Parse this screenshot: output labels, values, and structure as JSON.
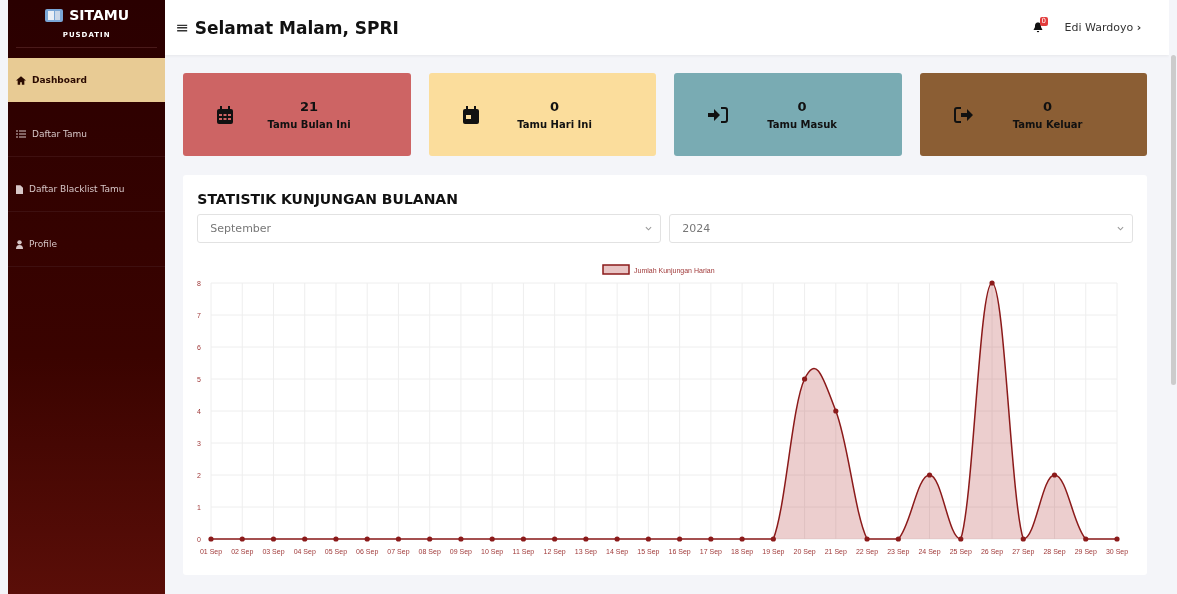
{
  "sidebar": {
    "brand": "SITAMU",
    "subtitle": "PUSDATIN",
    "items": [
      {
        "label": "Dashboard",
        "kind": "home",
        "selected": true
      },
      {
        "label": "Daftar Tamu",
        "kind": "list",
        "selected": false
      },
      {
        "label": "Daftar Blacklist Tamu",
        "kind": "file",
        "selected": false
      },
      {
        "label": "Profile",
        "kind": "user",
        "selected": false
      }
    ]
  },
  "header": {
    "menu_glyph": "≡",
    "greeting": "Selamat Malam, SPRI",
    "notification_count": "0",
    "user": "Edi Wardoyo",
    "user_caret": "›"
  },
  "cards": [
    {
      "value": "21",
      "label": "Tamu Bulan Ini",
      "kind": "calendar-grid",
      "color": "#cd6464"
    },
    {
      "value": "0",
      "label": "Tamu Hari Ini",
      "kind": "calendar-day",
      "color": "#fbdd9c"
    },
    {
      "value": "0",
      "label": "Tamu Masuk",
      "kind": "sign-in",
      "color": "#79abb3"
    },
    {
      "value": "0",
      "label": "Tamu Keluar",
      "kind": "sign-out",
      "color": "#8b5e34"
    }
  ],
  "stats": {
    "title": "STATISTIK KUNJUNGAN BULANAN",
    "month": "September",
    "year": "2024",
    "chart_data": {
      "type": "area",
      "categories": [
        "01 Sep",
        "02 Sep",
        "03 Sep",
        "04 Sep",
        "05 Sep",
        "06 Sep",
        "07 Sep",
        "08 Sep",
        "09 Sep",
        "10 Sep",
        "11 Sep",
        "12 Sep",
        "13 Sep",
        "14 Sep",
        "15 Sep",
        "16 Sep",
        "17 Sep",
        "18 Sep",
        "19 Sep",
        "20 Sep",
        "21 Sep",
        "22 Sep",
        "23 Sep",
        "24 Sep",
        "25 Sep",
        "26 Sep",
        "27 Sep",
        "28 Sep",
        "29 Sep",
        "30 Sep"
      ],
      "series": [
        {
          "name": "Jumlah Kunjungan Harian",
          "color": "#8b1a1a",
          "values": [
            0,
            0,
            0,
            0,
            0,
            0,
            0,
            0,
            0,
            0,
            0,
            0,
            0,
            0,
            0,
            0,
            0,
            0,
            0,
            5,
            4,
            0,
            0,
            2,
            0,
            8,
            0,
            2,
            0,
            0
          ]
        }
      ],
      "ylim": [
        0,
        8
      ],
      "grid": true,
      "yticks": [
        0,
        1,
        2,
        3,
        4,
        5,
        6,
        7,
        8
      ]
    }
  }
}
